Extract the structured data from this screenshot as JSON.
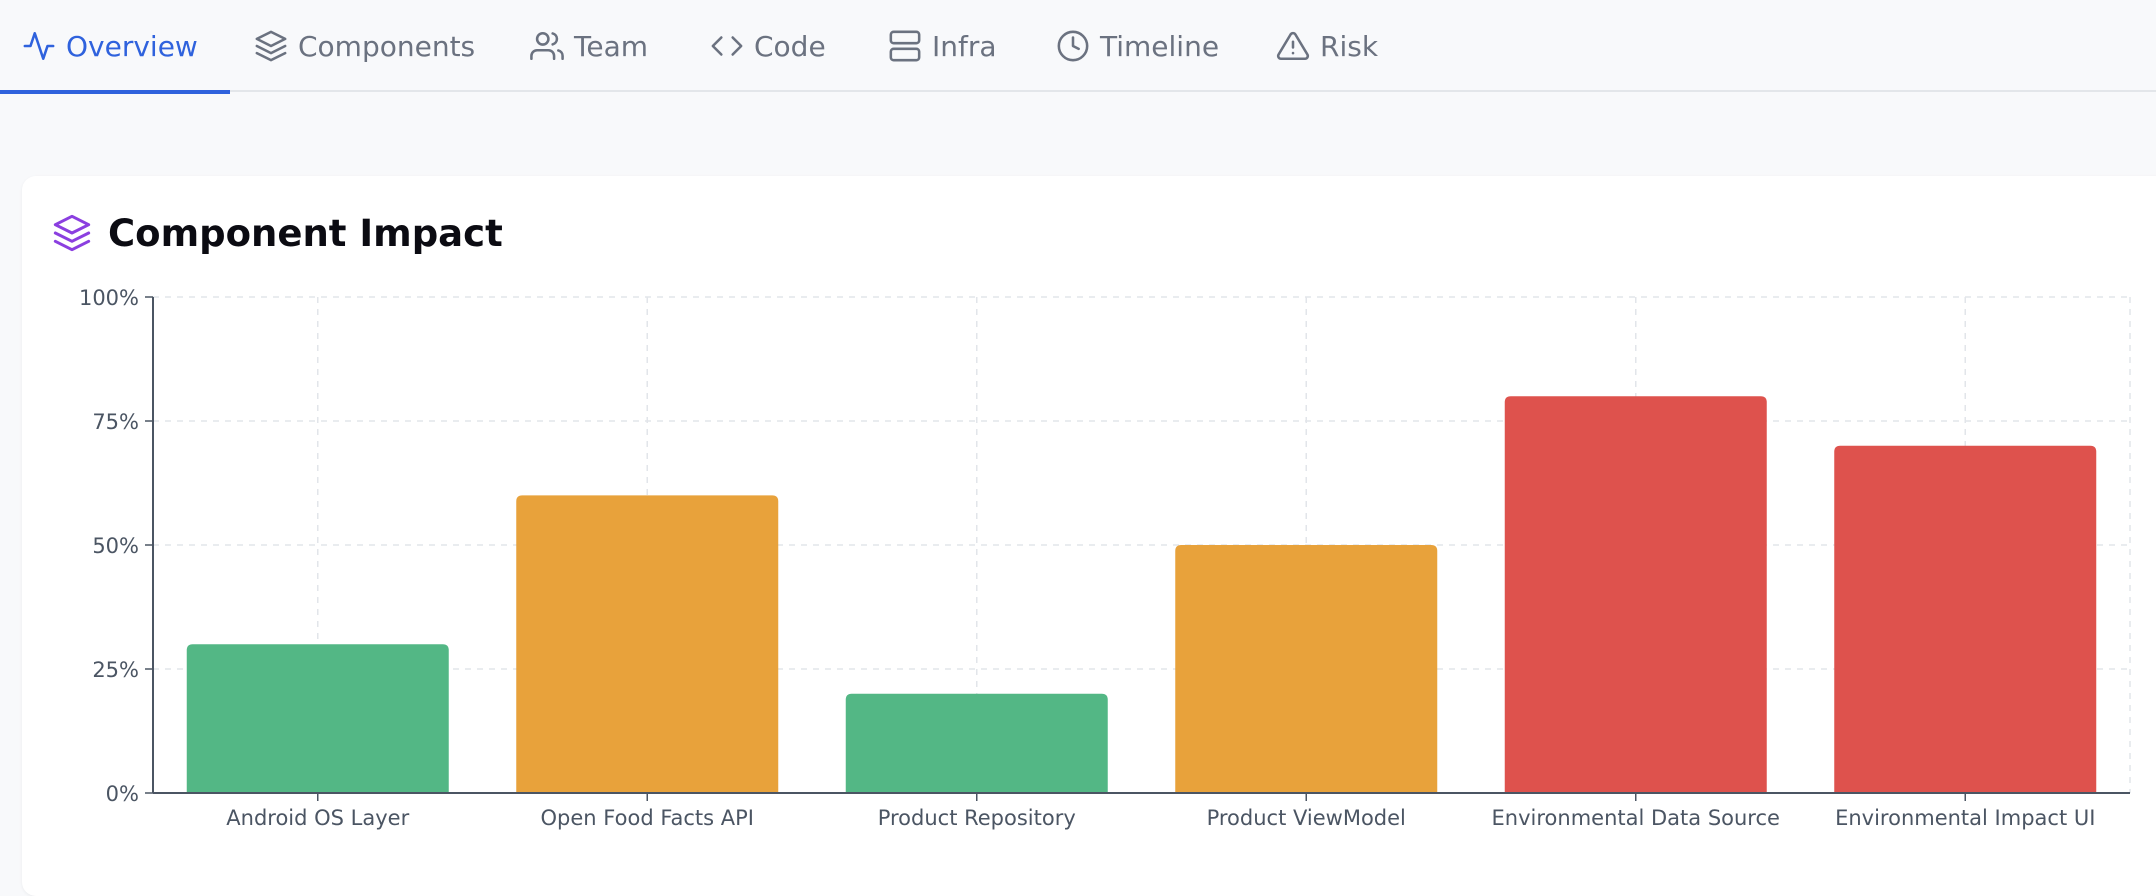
{
  "tabs": [
    {
      "label": "Overview",
      "icon": "activity-icon",
      "active": true
    },
    {
      "label": "Components",
      "icon": "layers-icon",
      "active": false
    },
    {
      "label": "Team",
      "icon": "users-icon",
      "active": false
    },
    {
      "label": "Code",
      "icon": "code-icon",
      "active": false
    },
    {
      "label": "Infra",
      "icon": "server-icon",
      "active": false
    },
    {
      "label": "Timeline",
      "icon": "clock-icon",
      "active": false
    },
    {
      "label": "Risk",
      "icon": "alert-triangle-icon",
      "active": false
    }
  ],
  "card": {
    "title": "Component Impact",
    "icon": "layers-icon"
  },
  "colors": {
    "accent": "#2f62dd",
    "low": "#53b785",
    "medium": "#e8a23b",
    "high": "#de524d",
    "title_icon": "#8b3fe0"
  },
  "chart_data": {
    "type": "bar",
    "categories": [
      "Android OS Layer",
      "Open Food Facts API",
      "Product Repository",
      "Product ViewModel",
      "Environmental Data Source",
      "Environmental Impact UI"
    ],
    "values": [
      30,
      60,
      20,
      50,
      80,
      70
    ],
    "bar_colors": [
      "#53b785",
      "#e8a23b",
      "#53b785",
      "#e8a23b",
      "#de524d",
      "#de524d"
    ],
    "ylim": [
      0,
      100
    ],
    "yticks": [
      "0%",
      "25%",
      "50%",
      "75%",
      "100%"
    ],
    "xlabel": "",
    "ylabel": "",
    "grid": true
  }
}
